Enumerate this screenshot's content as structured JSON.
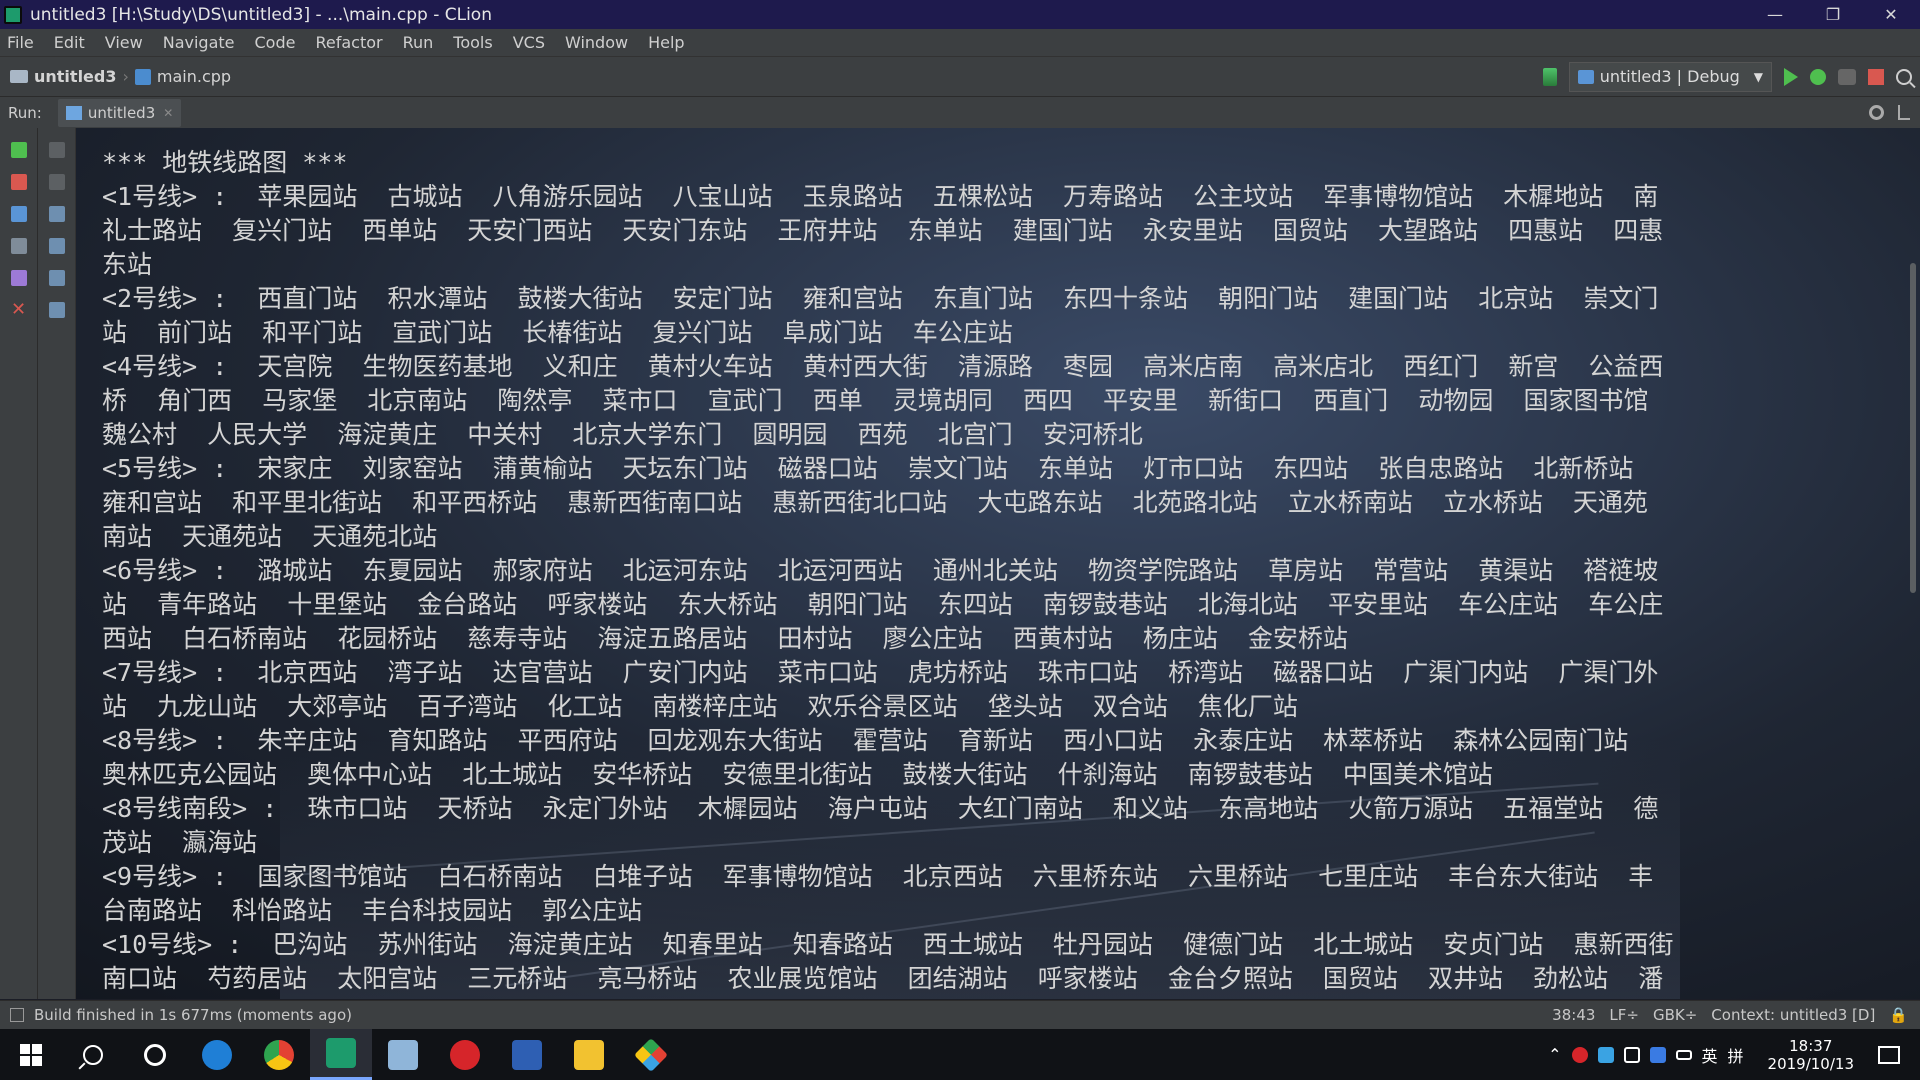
{
  "window": {
    "title": "untitled3 [H:\\Study\\DS\\untitled3] - ...\\main.cpp - CLion",
    "minimize": "—",
    "restore": "❐",
    "close": "✕"
  },
  "menu": [
    "File",
    "Edit",
    "View",
    "Navigate",
    "Code",
    "Refactor",
    "Run",
    "Tools",
    "VCS",
    "Window",
    "Help"
  ],
  "navbar": {
    "project": "untitled3",
    "file": "main.cpp",
    "run_config": "untitled3 | Debug"
  },
  "run_panel": {
    "label": "Run:",
    "tab": "untitled3"
  },
  "console_lines": [
    "*** 地铁线路图 ***",
    "<1号线> :  苹果园站  古城站  八角游乐园站  八宝山站  玉泉路站  五棵松站  万寿路站  公主坟站  军事博物馆站  木樨地站  南",
    "礼士路站  复兴门站  西单站  天安门西站  天安门东站  王府井站  东单站  建国门站  永安里站  国贸站  大望路站  四惠站  四惠",
    "东站",
    "<2号线> :  西直门站  积水潭站  鼓楼大街站  安定门站  雍和宫站  东直门站  东四十条站  朝阳门站  建国门站  北京站  崇文门",
    "站  前门站  和平门站  宣武门站  长椿街站  复兴门站  阜成门站  车公庄站",
    "<4号线> :  天宫院  生物医药基地  义和庄  黄村火车站  黄村西大街  清源路  枣园  高米店南  高米店北  西红门  新宫  公益西",
    "桥  角门西  马家堡  北京南站  陶然亭  菜市口  宣武门  西单  灵境胡同  西四  平安里  新街口  西直门  动物园  国家图书馆",
    "魏公村  人民大学  海淀黄庄  中关村  北京大学东门  圆明园  西苑  北宫门  安河桥北",
    "<5号线> :  宋家庄  刘家窑站  蒲黄榆站  天坛东门站  磁器口站  崇文门站  东单站  灯市口站  东四站  张自忠路站  北新桥站",
    "雍和宫站  和平里北街站  和平西桥站  惠新西街南口站  惠新西街北口站  大屯路东站  北苑路北站  立水桥南站  立水桥站  天通苑",
    "南站  天通苑站  天通苑北站",
    "<6号线> :  潞城站  东夏园站  郝家府站  北运河东站  北运河西站  通州北关站  物资学院路站  草房站  常营站  黄渠站  褡裢坡",
    "站  青年路站  十里堡站  金台路站  呼家楼站  东大桥站  朝阳门站  东四站  南锣鼓巷站  北海北站  平安里站  车公庄站  车公庄",
    "西站  白石桥南站  花园桥站  慈寿寺站  海淀五路居站  田村站  廖公庄站  西黄村站  杨庄站  金安桥站",
    "<7号线> :  北京西站  湾子站  达官营站  广安门内站  菜市口站  虎坊桥站  珠市口站  桥湾站  磁器口站  广渠门内站  广渠门外",
    "站  九龙山站  大郊亭站  百子湾站  化工站  南楼梓庄站  欢乐谷景区站  垡头站  双合站  焦化厂站",
    "<8号线> :  朱辛庄站  育知路站  平西府站  回龙观东大街站  霍营站  育新站  西小口站  永泰庄站  林萃桥站  森林公园南门站",
    "奥林匹克公园站  奥体中心站  北土城站  安华桥站  安德里北街站  鼓楼大街站  什刹海站  南锣鼓巷站  中国美术馆站",
    "<8号线南段> :  珠市口站  天桥站  永定门外站  木樨园站  海户屯站  大红门南站  和义站  东高地站  火箭万源站  五福堂站  德",
    "茂站  瀛海站",
    "<9号线> :  国家图书馆站  白石桥南站  白堆子站  军事博物馆站  北京西站  六里桥东站  六里桥站  七里庄站  丰台东大街站  丰",
    "台南路站  科怡路站  丰台科技园站  郭公庄站",
    "<10号线> :  巴沟站  苏州街站  海淀黄庄站  知春里站  知春路站  西土城站  牡丹园站  健德门站  北土城站  安贞门站  惠新西街",
    "南口站  芍药居站  太阳宫站  三元桥站  亮马桥站  农业展览馆站  团结湖站  呼家楼站  金台夕照站  国贸站  双井站  劲松站  潘"
  ],
  "status": {
    "message": "Build finished in 1s 677ms (moments ago)",
    "position": "38:43",
    "line_sep": "LF÷",
    "encoding": "GBK÷",
    "context": "Context: untitled3 [D]"
  },
  "taskbar": {
    "time": "18:37",
    "date": "2019/10/13",
    "ime": "英",
    "ime2": "拼"
  }
}
